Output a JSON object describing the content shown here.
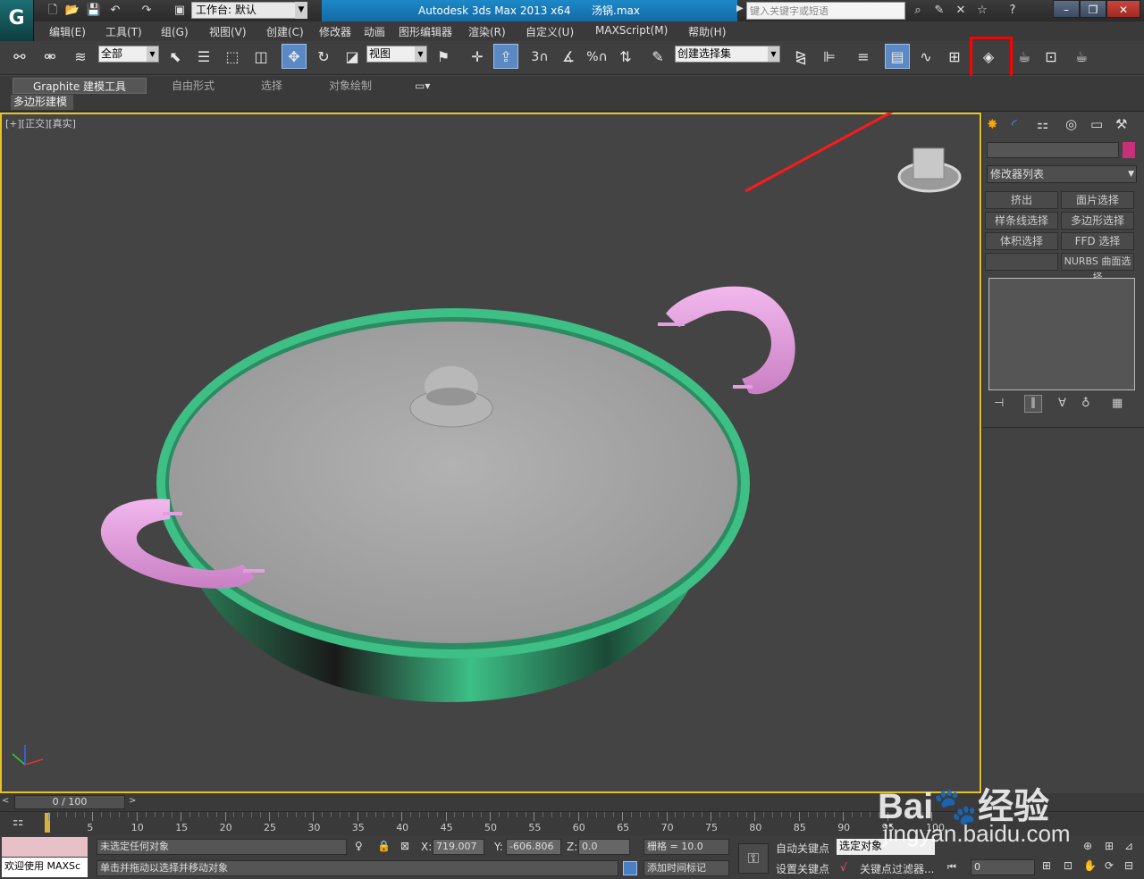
{
  "app": {
    "workspace_label": "工作台: 默认",
    "product": "Autodesk 3ds Max  2013 x64",
    "file_name": "汤锅.max",
    "search_placeholder": "键入关键字或短语"
  },
  "menus": [
    "编辑(E)",
    "工具(T)",
    "组(G)",
    "视图(V)",
    "创建(C)",
    "修改器",
    "动画",
    "图形编辑器",
    "渲染(R)",
    "自定义(U)",
    "MAXScript(M)",
    "帮助(H)"
  ],
  "toolbar": {
    "filter_value": "全部",
    "ref_coord_value": "视图",
    "selection_set_value": "创建选择集",
    "snap_3_label": "3",
    "percent_label": "%"
  },
  "ribbon": {
    "tabs": [
      "Graphite 建模工具",
      "自由形式",
      "选择",
      "对象绘制"
    ],
    "subpanel": "多边形建模"
  },
  "viewport": {
    "label": "[+][正交][真实]"
  },
  "command_panel": {
    "modifier_list": "修改器列表",
    "buttons": [
      "挤出",
      "面片选择",
      "样条线选择",
      "多边形选择",
      "体积选择",
      "FFD 选择",
      "",
      "NURBS 曲面选择"
    ],
    "color_swatch": "#c8307a"
  },
  "timeline": {
    "frame_label": "0 / 100",
    "ticks": [
      "0",
      "5",
      "10",
      "15",
      "20",
      "25",
      "30",
      "35",
      "40",
      "45",
      "50",
      "55",
      "60",
      "65",
      "70",
      "75",
      "80",
      "85",
      "90",
      "95",
      "100"
    ]
  },
  "status": {
    "maxscript_welcome": "欢迎使用 MAXSc",
    "selection_status": "未选定任何对象",
    "prompt": "单击并拖动以选择并移动对象",
    "x_label": "X:",
    "x_value": "719.007",
    "y_label": "Y:",
    "y_value": "-606.806",
    "z_label": "Z:",
    "z_value": "0.0",
    "grid": "栅格 = 10.0",
    "add_time_tag": "添加时间标记",
    "auto_key": "自动关键点",
    "selected_object": "选定对象",
    "set_key": "设置关键点",
    "key_filters": "关键点过滤器...",
    "frame_field": "0"
  },
  "watermark": {
    "brand": "Bai",
    "brand2": "经验",
    "url": "jingyan.baidu.com"
  },
  "colors": {
    "pot_body": "#3dbf86",
    "handle": "#e59de0",
    "lid": "#a8a8a8",
    "highlight_box": "#ff0000",
    "arrow": "#ff0000"
  }
}
